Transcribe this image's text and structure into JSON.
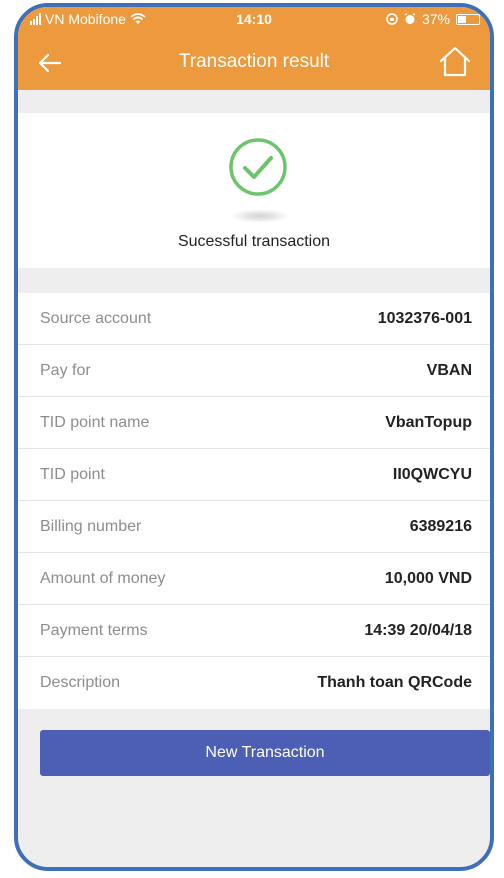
{
  "status_bar": {
    "carrier": "VN Mobifone",
    "time": "14:10",
    "battery": "37%"
  },
  "nav": {
    "title": "Transaction result"
  },
  "result": {
    "message": "Sucessful transaction"
  },
  "details": [
    {
      "label": "Source account",
      "value": "1032376-001"
    },
    {
      "label": "Pay for",
      "value": "VBAN"
    },
    {
      "label": "TID point name",
      "value": "VbanTopup"
    },
    {
      "label": "TID point",
      "value": "II0QWCYU"
    },
    {
      "label": "Billing number",
      "value": "6389216"
    },
    {
      "label": "Amount of money",
      "value": "10,000 VND"
    },
    {
      "label": "Payment terms",
      "value": "14:39 20/04/18"
    },
    {
      "label": "Description",
      "value": "Thanh toan QRCode"
    }
  ],
  "actions": {
    "new_transaction": "New Transaction"
  },
  "colors": {
    "header": "#ec9a3d",
    "success": "#6cc46b",
    "button": "#4c5fb4",
    "frame": "#3f6fb6"
  },
  "icons": {
    "back": "arrow-left-icon",
    "home": "home-icon",
    "success": "check-circle-icon",
    "wifi": "wifi-icon",
    "alarm": "alarm-icon",
    "lock": "rotation-lock-icon",
    "battery": "battery-icon"
  }
}
